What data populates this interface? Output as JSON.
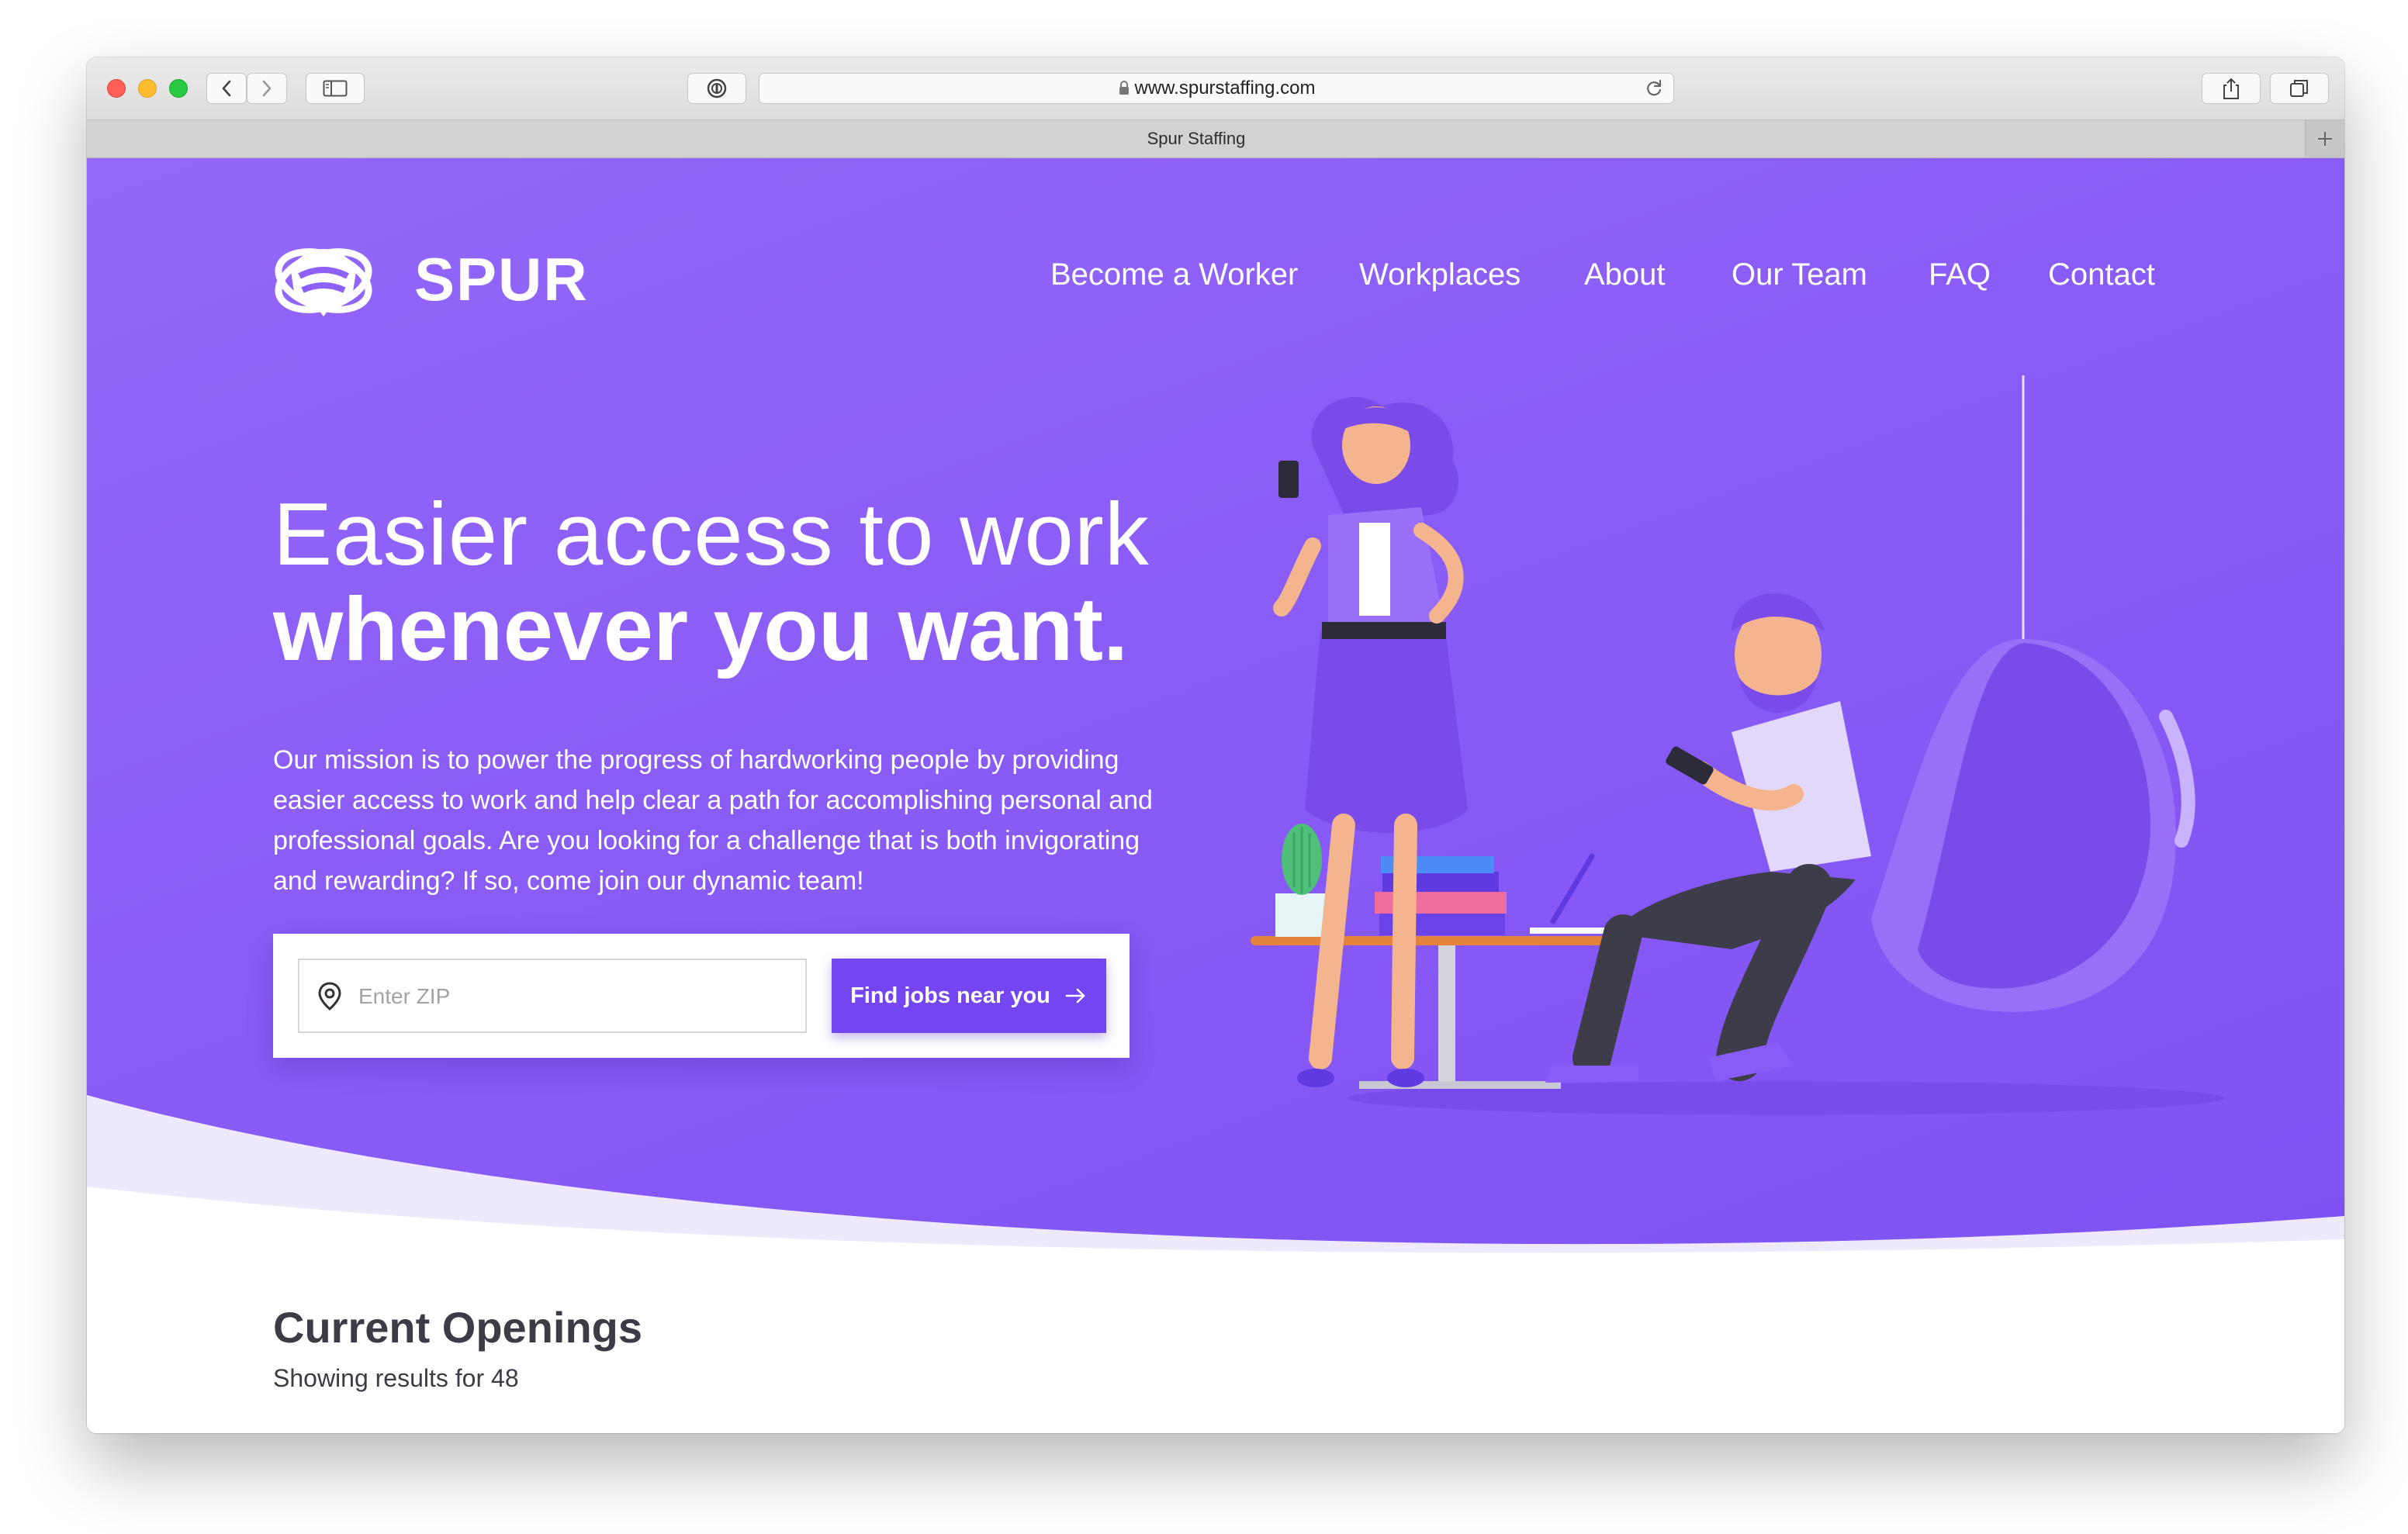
{
  "browser": {
    "url": "www.spurstaffing.com",
    "tab_title": "Spur Staffing"
  },
  "brand": {
    "name": "SPUR"
  },
  "nav": [
    {
      "label": "Become a Worker"
    },
    {
      "label": "Workplaces"
    },
    {
      "label": "About"
    },
    {
      "label": "Our Team"
    },
    {
      "label": "FAQ"
    },
    {
      "label": "Contact"
    }
  ],
  "hero": {
    "headline_line1": "Easier access to work",
    "headline_line2": "whenever you want.",
    "mission": "Our mission is to power the progress of hardworking people by providing easier access to work and help clear a path for accomplishing personal and professional goals. Are you looking for a challenge that is both invigorating and rewarding? If so, come join our dynamic team!",
    "zip_placeholder": "Enter ZIP",
    "zip_value": "",
    "button_label": "Find jobs near you"
  },
  "openings": {
    "title": "Current Openings",
    "subtitle": "Showing results for 48"
  },
  "colors": {
    "brand_purple": "#8a5cf6",
    "button_purple": "#7446f2",
    "text_dark": "#3c3c46"
  },
  "icons": {
    "location": "location-pin-icon",
    "arrow": "arrow-right-icon",
    "lock": "lock-icon",
    "reload": "reload-icon"
  }
}
